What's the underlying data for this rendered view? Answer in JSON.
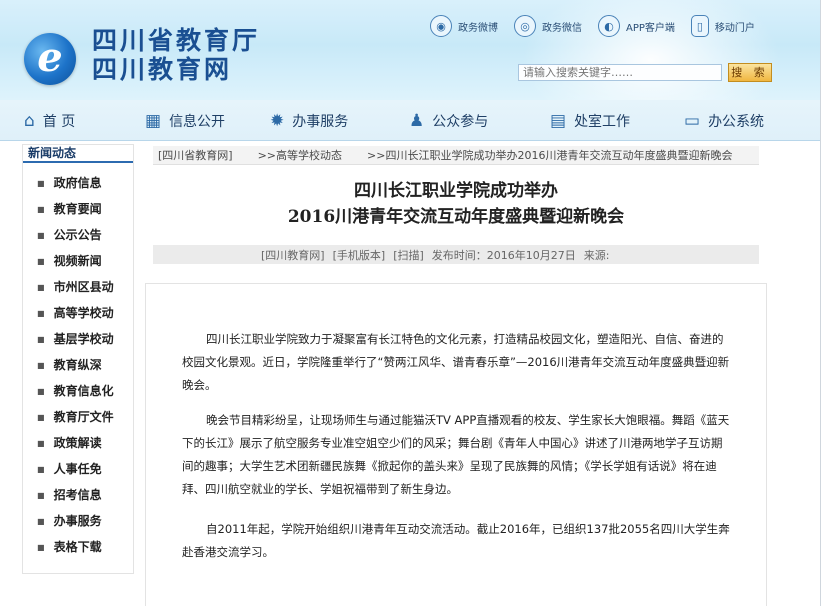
{
  "header": {
    "logo_letter": "e",
    "site_name_line1": "四川省教育厅",
    "site_name_line2": "四川教育网",
    "top_links": [
      {
        "label": "政务微博",
        "icon": "weibo-icon",
        "glyph": "◉"
      },
      {
        "label": "政务微信",
        "icon": "wechat-icon",
        "glyph": "◎"
      },
      {
        "label": "APP客户端",
        "icon": "app-icon",
        "glyph": "◐"
      },
      {
        "label": "移动门户",
        "icon": "mobile-icon",
        "glyph": "▯"
      }
    ],
    "search_placeholder": "请输入搜索关键字……",
    "search_button": "搜 索"
  },
  "nav": [
    {
      "label": "首 页",
      "icon": "home-icon",
      "glyph": "⌂"
    },
    {
      "label": "信息公开",
      "icon": "building-icon",
      "glyph": "▦"
    },
    {
      "label": "办事服务",
      "icon": "gear-icon",
      "glyph": "✹"
    },
    {
      "label": "公众参与",
      "icon": "people-icon",
      "glyph": "♟"
    },
    {
      "label": "处室工作",
      "icon": "calendar-icon",
      "glyph": "▤"
    },
    {
      "label": "办公系统",
      "icon": "monitor-icon",
      "glyph": "▭"
    }
  ],
  "sidebar": {
    "heading": "新闻动态",
    "items": [
      {
        "label": "政府信息"
      },
      {
        "label": "教育要闻"
      },
      {
        "label": "公示公告"
      },
      {
        "label": "视频新闻"
      },
      {
        "label": "市州区县动"
      },
      {
        "label": "高等学校动"
      },
      {
        "label": "基层学校动"
      },
      {
        "label": "教育纵深"
      },
      {
        "label": "教育信息化"
      },
      {
        "label": "教育厅文件"
      },
      {
        "label": "政策解读"
      },
      {
        "label": "人事任免"
      },
      {
        "label": "招考信息"
      },
      {
        "label": "办事服务"
      },
      {
        "label": "表格下载"
      }
    ]
  },
  "breadcrumb": [
    "[四川省教育网]",
    ">>高等学校动态",
    ">>四川长江职业学院成功举办2016川港青年交流互动年度盛典暨迎新晚会"
  ],
  "article": {
    "title_line1": "四川长江职业学院成功举办",
    "title_line2": "2016川港青年交流互动年度盛典暨迎新晚会",
    "meta": {
      "source": "[四川教育网]",
      "mobile": "[手机版本]",
      "scan": "[扫描]",
      "publish": "发布时间：2016年10月27日",
      "origin": "来源:"
    },
    "paragraphs": [
      "四川长江职业学院致力于凝聚富有长江特色的文化元素，打造精品校园文化，塑造阳光、自信、奋进的校园文化景观。近日，学院隆重举行了“赞两江风华、谱青春乐章”—2016川港青年交流互动年度盛典暨迎新晚会。",
      "晚会节目精彩纷呈，让现场师生与通过能猫沃TV APP直播观看的校友、学生家长大饱眼福。舞蹈《蓝天下的长江》展示了航空服务专业准空姐空少们的风采；舞台剧《青年人中国心》讲述了川港两地学子互访期间的趣事；大学生艺术团新疆民族舞《掀起你的盖头来》呈现了民族舞的风情；《学长学姐有话说》将在迪拜、四川航空就业的学长、学姐祝福带到了新生身边。",
      "自2011年起，学院开始组织川港青年互动交流活动。截止2016年，已组织137批2055名四川大学生奔赴香港交流学习。"
    ]
  }
}
